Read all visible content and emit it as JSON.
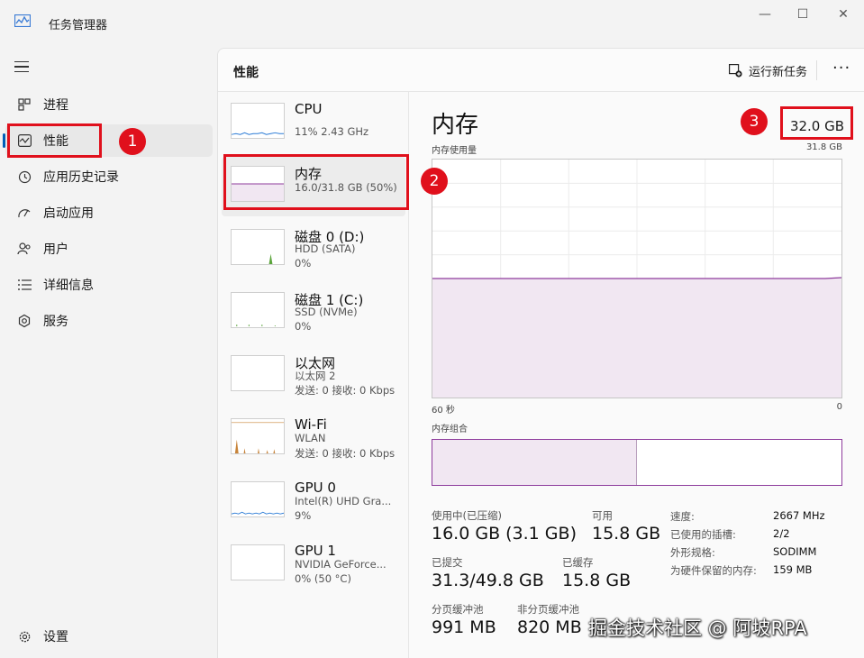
{
  "window": {
    "title": "任务管理器",
    "minimize": "—",
    "maximize": "☐",
    "close": "✕"
  },
  "nav": {
    "items": [
      {
        "label": "进程",
        "icon": "processes-icon"
      },
      {
        "label": "性能",
        "icon": "performance-icon",
        "active": true
      },
      {
        "label": "应用历史记录",
        "icon": "app-history-icon"
      },
      {
        "label": "启动应用",
        "icon": "startup-apps-icon"
      },
      {
        "label": "用户",
        "icon": "users-icon"
      },
      {
        "label": "详细信息",
        "icon": "details-icon"
      },
      {
        "label": "服务",
        "icon": "services-icon"
      }
    ],
    "settings_label": "设置"
  },
  "header": {
    "title": "性能",
    "run_task": "运行新任务",
    "more": "···"
  },
  "resources": [
    {
      "name": "CPU",
      "sub1": "11% 2.43 GHz",
      "sub2": ""
    },
    {
      "name": "内存",
      "sub1": "16.0/31.8 GB (50%)",
      "sub2": ""
    },
    {
      "name": "磁盘 0 (D:)",
      "sub1": "HDD (SATA)",
      "sub2": "0%"
    },
    {
      "name": "磁盘 1 (C:)",
      "sub1": "SSD (NVMe)",
      "sub2": "0%"
    },
    {
      "name": "以太网",
      "sub1": "以太网 2",
      "sub2": "发送: 0 接收: 0 Kbps"
    },
    {
      "name": "Wi-Fi",
      "sub1": "WLAN",
      "sub2": "发送: 0 接收: 0 Kbps"
    },
    {
      "name": "GPU 0",
      "sub1": "Intel(R) UHD Gra...",
      "sub2": "9%"
    },
    {
      "name": "GPU 1",
      "sub1": "NVIDIA GeForce...",
      "sub2": "0% (50 °C)"
    }
  ],
  "memory": {
    "title": "内存",
    "total": "32.0 GB",
    "usage_label": "内存使用量",
    "usage_max": "31.8 GB",
    "time_left": "60 秒",
    "time_right": "0",
    "composition_label": "内存组合",
    "usage_fraction": 0.5,
    "composition_in_use_fraction": 0.5,
    "stats": {
      "in_use_label": "使用中(已压缩)",
      "in_use_value": "16.0 GB (3.1 GB)",
      "available_label": "可用",
      "available_value": "15.8 GB",
      "committed_label": "已提交",
      "committed_value": "31.3/49.8 GB",
      "cached_label": "已缓存",
      "cached_value": "15.8 GB",
      "paged_label": "分页缓冲池",
      "paged_value": "991 MB",
      "nonpaged_label": "非分页缓冲池",
      "nonpaged_value": "820 MB"
    },
    "details": [
      {
        "k": "速度:",
        "v": "2667 MHz"
      },
      {
        "k": "已使用的插槽:",
        "v": "2/2"
      },
      {
        "k": "外形规格:",
        "v": "SODIMM"
      },
      {
        "k": "为硬件保留的内存:",
        "v": "159 MB"
      }
    ]
  },
  "annotations": [
    "1",
    "2",
    "3"
  ],
  "watermark": "掘金技术社区 @ 阿坡RPA",
  "colors": {
    "accent": "#005fb8",
    "memory": "#8e3b9c",
    "annotation": "#e0101c"
  }
}
